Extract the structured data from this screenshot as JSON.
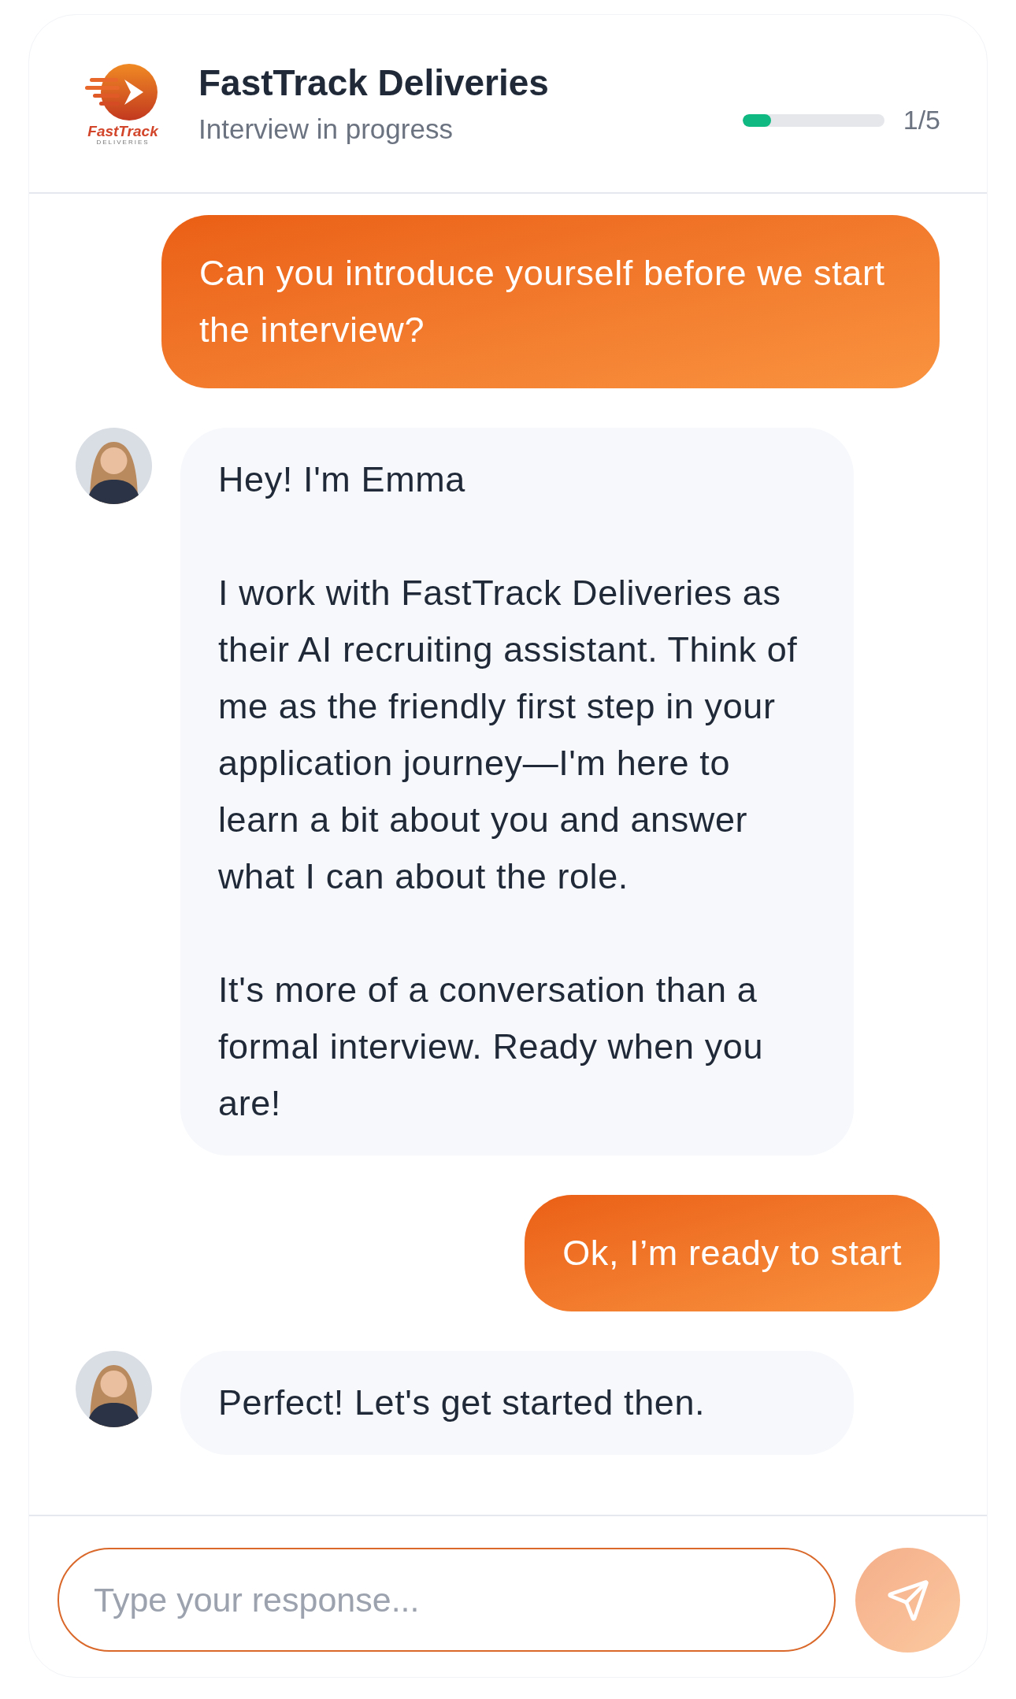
{
  "header": {
    "logo": {
      "wordmark": "FastTrack",
      "tagline": "DELIVERIES"
    },
    "title": "FastTrack Deliveries",
    "subtitle": "Interview in progress",
    "progress": {
      "level": 0.2,
      "reading": "1/5"
    }
  },
  "messages": [
    {
      "kind": "user",
      "paragraphs": [
        "Can you introduce yourself before we start the interview?"
      ]
    },
    {
      "kind": "assistant",
      "paragraphs": [
        "Hey! I'm Emma",
        "I work with FastTrack Deliveries as their AI recruiting assistant. Think of me as the friendly first step in your application journey—I'm here to learn a bit about you and answer what I can about the role.",
        "It's more of a conversation than a formal interview. Ready when you are!"
      ]
    },
    {
      "kind": "user",
      "paragraphs": [
        "Ok, I’m ready to start"
      ]
    },
    {
      "kind": "assistant",
      "paragraphs": [
        "Perfect! Let's get started then."
      ]
    }
  ],
  "composer": {
    "placeholder": "Type your response...",
    "send_disabled": true
  }
}
